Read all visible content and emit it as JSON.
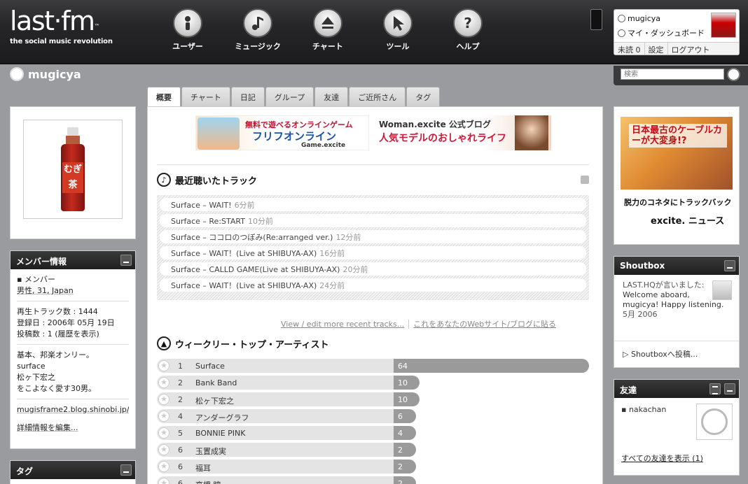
{
  "brand": {
    "wordmark": "last·fm",
    "tm": "™",
    "tagline": "the social music revolution"
  },
  "nav": [
    {
      "label": "ユーザー",
      "icon": "user-icon"
    },
    {
      "label": "ミュージック",
      "icon": "music-note-icon"
    },
    {
      "label": "チャート",
      "icon": "chart-up-icon"
    },
    {
      "label": "ツール",
      "icon": "cursor-icon"
    },
    {
      "label": "ヘルプ",
      "icon": "help-icon"
    }
  ],
  "userbox": {
    "username": "mugicya",
    "dashboard": "マイ・ダッシュボード",
    "unread": "未読 0",
    "settings": "設定",
    "logout": "ログアウト"
  },
  "page": {
    "title": "mugicya"
  },
  "search": {
    "placeholder": "検索"
  },
  "tabs": [
    "概要",
    "チャート",
    "日記",
    "グループ",
    "友達",
    "ご近所さん",
    "タグ"
  ],
  "ads": {
    "left": {
      "line1": "無料で遊べるオンラインゲーム",
      "line2": "フリフオンライン",
      "line3": "Game.excite"
    },
    "right": {
      "line1": "Woman.excite 公式ブログ",
      "line2": "人気モデルのおしゃれライフ"
    }
  },
  "recent": {
    "title": "最近聴いたトラック",
    "tracks": [
      {
        "text": "Surface – WAIT!",
        "ago": "6分前"
      },
      {
        "text": "Surface – Re:START",
        "ago": "10分前"
      },
      {
        "text": "Surface – ココロのつぼみ(Re:arranged ver.)",
        "ago": "12分前"
      },
      {
        "text": "Surface – WAIT！(Live at SHIBUYA-AX)",
        "ago": "16分前"
      },
      {
        "text": "Surface – CALLD GAME(Live at SHIBUYA-AX)",
        "ago": "20分前"
      },
      {
        "text": "Surface – WAIT！(Live at SHIBUYA-AX)",
        "ago": "24分前"
      }
    ],
    "edit_link": "View / edit more recent tracks...",
    "blog_link": "これをあなたのWebサイト/ブログに貼る"
  },
  "weekly": {
    "title": "ウィークリー・トップ・アーティスト",
    "max": 64,
    "artists": [
      {
        "rank": "1",
        "name": "Surface",
        "count": 64
      },
      {
        "rank": "2",
        "name": "Bank Band",
        "count": 10
      },
      {
        "rank": "2",
        "name": "松ヶ下宏之",
        "count": 10
      },
      {
        "rank": "4",
        "name": "アンダーグラフ",
        "count": 6
      },
      {
        "rank": "5",
        "name": "BONNIE PINK",
        "count": 4
      },
      {
        "rank": "6",
        "name": "玉置成実",
        "count": 2
      },
      {
        "rank": "6",
        "name": "福耳",
        "count": 2
      },
      {
        "rank": "6",
        "name": "高橋 瞳",
        "count": 2
      }
    ]
  },
  "member": {
    "header": "メンバー情報",
    "type": "メンバー",
    "profile": "男性, 31, Japan",
    "plays": "再生トラック数 : 1444",
    "registered": "登録日 : 2006年 05月 19日",
    "posts": "投稿数 : 1 (履歴を表示)",
    "about": [
      "基本、邦楽オンリー。",
      "surface",
      "松ヶ下宏之",
      "をこよなく愛す30男。"
    ],
    "site": "mugisframe2.blog.shinobi.jp/",
    "edit": "詳細情報を編集..."
  },
  "tag_box": {
    "header": "タグ"
  },
  "right_ad": {
    "headline": "日本最古のケーブルカーが大変身!?",
    "caption": "脱力のコネタにトラックバック",
    "brand": "excite. ニュース"
  },
  "shoutbox": {
    "header": "Shoutbox",
    "author": "LAST.HQが言いました:",
    "message": "Welcome aboard, mugicya! Happy listening.",
    "date": "5月 2006",
    "post_link": "Shoutboxへ投稿..."
  },
  "friends": {
    "header": "友達",
    "name": "nakachan",
    "all_link": "すべての友達を表示 (1)"
  },
  "colors": {
    "header_bg": "#262628",
    "page_bg": "#9a9b9f",
    "bar": "#9a9a9a"
  }
}
